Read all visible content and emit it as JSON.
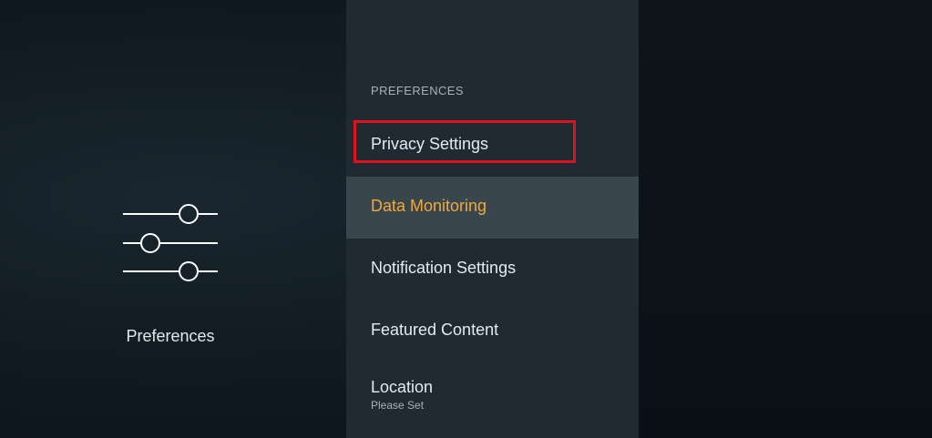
{
  "left_pane": {
    "icon": "sliders-icon",
    "label": "Preferences"
  },
  "menu": {
    "section_header": "PREFERENCES",
    "items": [
      {
        "label": "Privacy Settings",
        "highlighted": true
      },
      {
        "label": "Data Monitoring",
        "selected": true
      },
      {
        "label": "Notification Settings"
      },
      {
        "label": "Featured Content"
      },
      {
        "label": "Location",
        "sublabel": "Please Set"
      }
    ]
  },
  "colors": {
    "selected_text": "#f2a83a",
    "selected_background": "#39464e",
    "highlight_border": "#e0111c",
    "panel_background": "#1f2a32"
  }
}
